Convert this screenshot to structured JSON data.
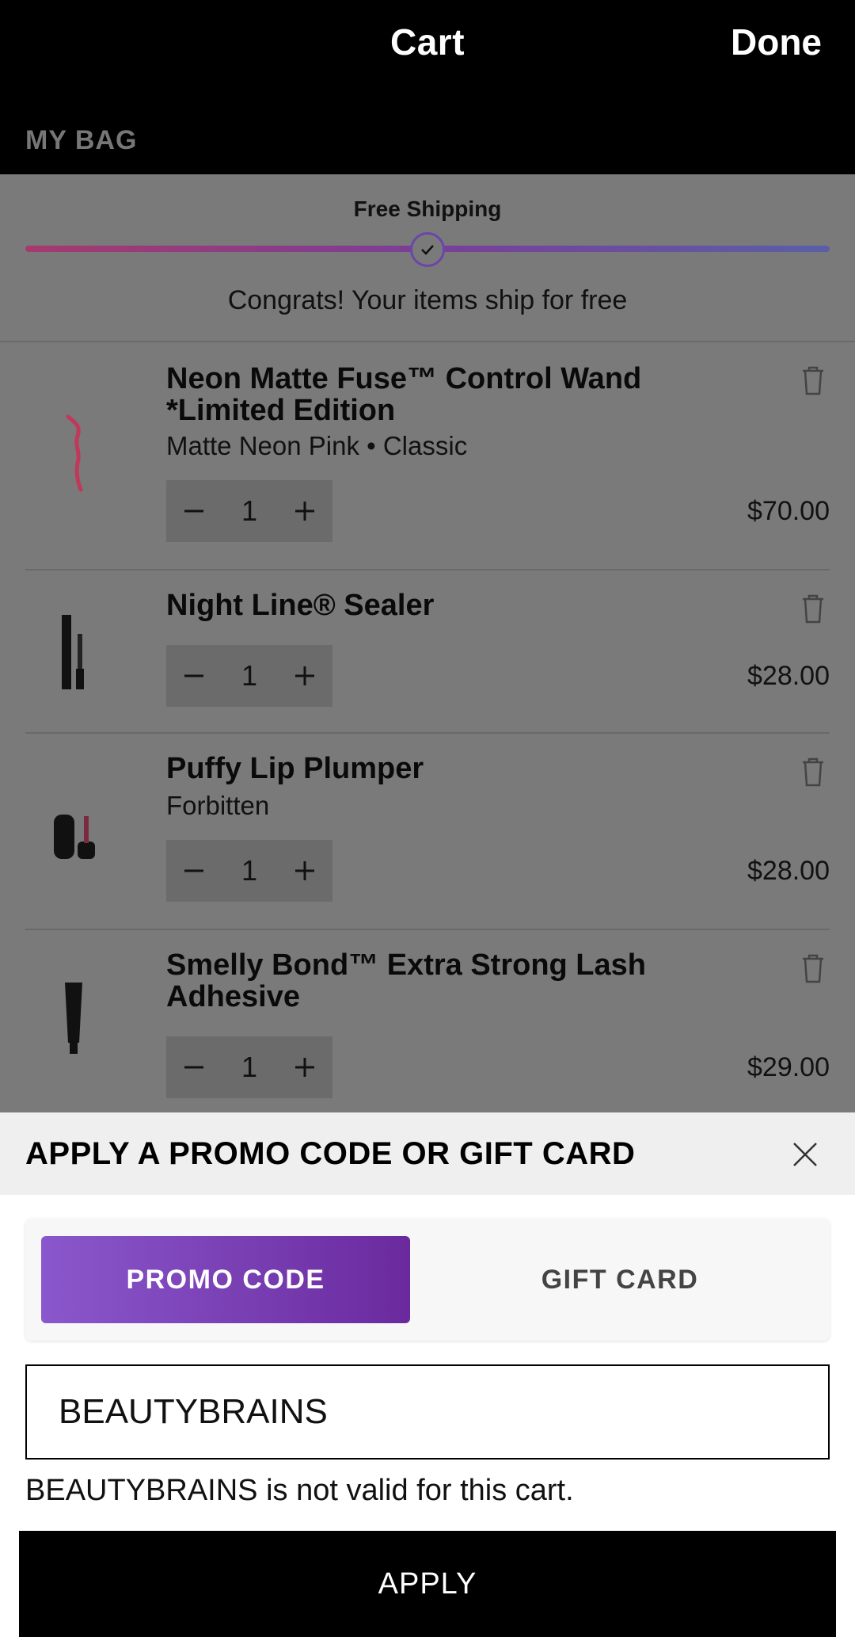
{
  "header": {
    "title": "Cart",
    "done_label": "Done",
    "section_label": "MY BAG"
  },
  "shipping": {
    "label": "Free Shipping",
    "message": "Congrats! Your items ship for free",
    "progress": 1.0
  },
  "items": [
    {
      "name_line1": "Neon Matte Fuse™ Control Wand",
      "name_line2": "*Limited Edition",
      "variant": "Matte Neon Pink • Classic",
      "quantity": "1",
      "price": "$70.00"
    },
    {
      "name_line1": "Night Line® Sealer",
      "name_line2": "",
      "variant": "",
      "quantity": "1",
      "price": "$28.00"
    },
    {
      "name_line1": "Puffy Lip Plumper",
      "name_line2": "",
      "variant": "Forbitten",
      "quantity": "1",
      "price": "$28.00"
    },
    {
      "name_line1": "Smelly Bond™ Extra Strong Lash",
      "name_line2": "Adhesive",
      "variant": "",
      "quantity": "1",
      "price": "$29.00"
    }
  ],
  "promo": {
    "heading": "APPLY A PROMO CODE OR GIFT CARD",
    "tab_promo": "PROMO CODE",
    "tab_gift": "GIFT CARD",
    "code_value": "BEAUTYBRAINS",
    "error": "BEAUTYBRAINS is not valid for this cart.",
    "apply_label": "APPLY"
  },
  "colors": {
    "promo_tab_start": "#8a58cc",
    "promo_tab_end": "#6a2a9e",
    "dim_overlay": "#7a7a7a"
  },
  "icons": [
    "check-icon",
    "trash-icon",
    "minus-icon",
    "plus-icon",
    "close-icon"
  ]
}
